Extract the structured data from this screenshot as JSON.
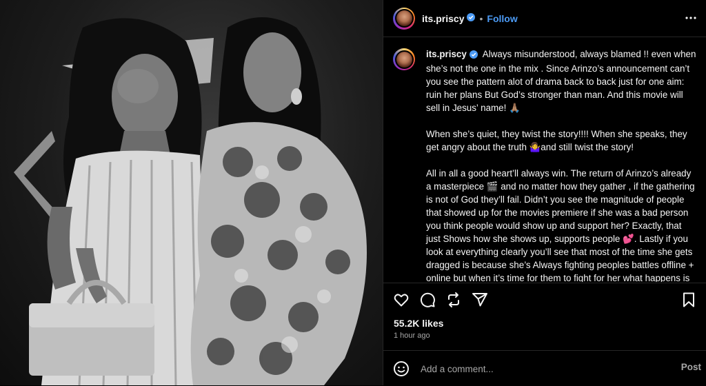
{
  "post": {
    "username": "its.priscy",
    "dot": "•",
    "follow_label": "Follow",
    "more_icon": "more-horizontal-icon",
    "photo_alt": "Black and white photo of two women posing together",
    "caption": {
      "p1": "Always misunderstood, always blamed !! even when she’s not the one in the mix . Since Arinzo’s announcement can’t you see the pattern alot of drama back to back just for one aim: ruin her plans But God’s stronger than man. And this movie will sell in Jesus’ name! 🙏🏽",
      "p2": "When she’s quiet, they twist the story!!!! When she speaks, they get angry about the truth 🤷‍♀️and still twist the story!",
      "p3": "All in all a good heart’ll always win. The return of Arinzo’s already a masterpiece 🎬 and no matter how they gather , if the gathering is not of God they’ll fail. Didn’t you see the magnitude of people that showed up for the movies premiere if she was a bad person you think people would show up and support her? Exactly, that just Shows how she shows up, supports people 💕. Lastly if you look at everything clearly you’ll see that most of the time she gets dragged is because she’s Always fighting peoples battles offline + online but when it’s time for them to fight for her what happens is that they go mute 😬 hmmm life"
    },
    "likes": "55.2K likes",
    "time": "1 hour ago",
    "comment_placeholder": "Add a comment...",
    "post_label": "Post"
  },
  "colors": {
    "accent": "#4c9bf5",
    "background": "#000000",
    "muted": "#a8a8a8",
    "divider": "#262626"
  }
}
